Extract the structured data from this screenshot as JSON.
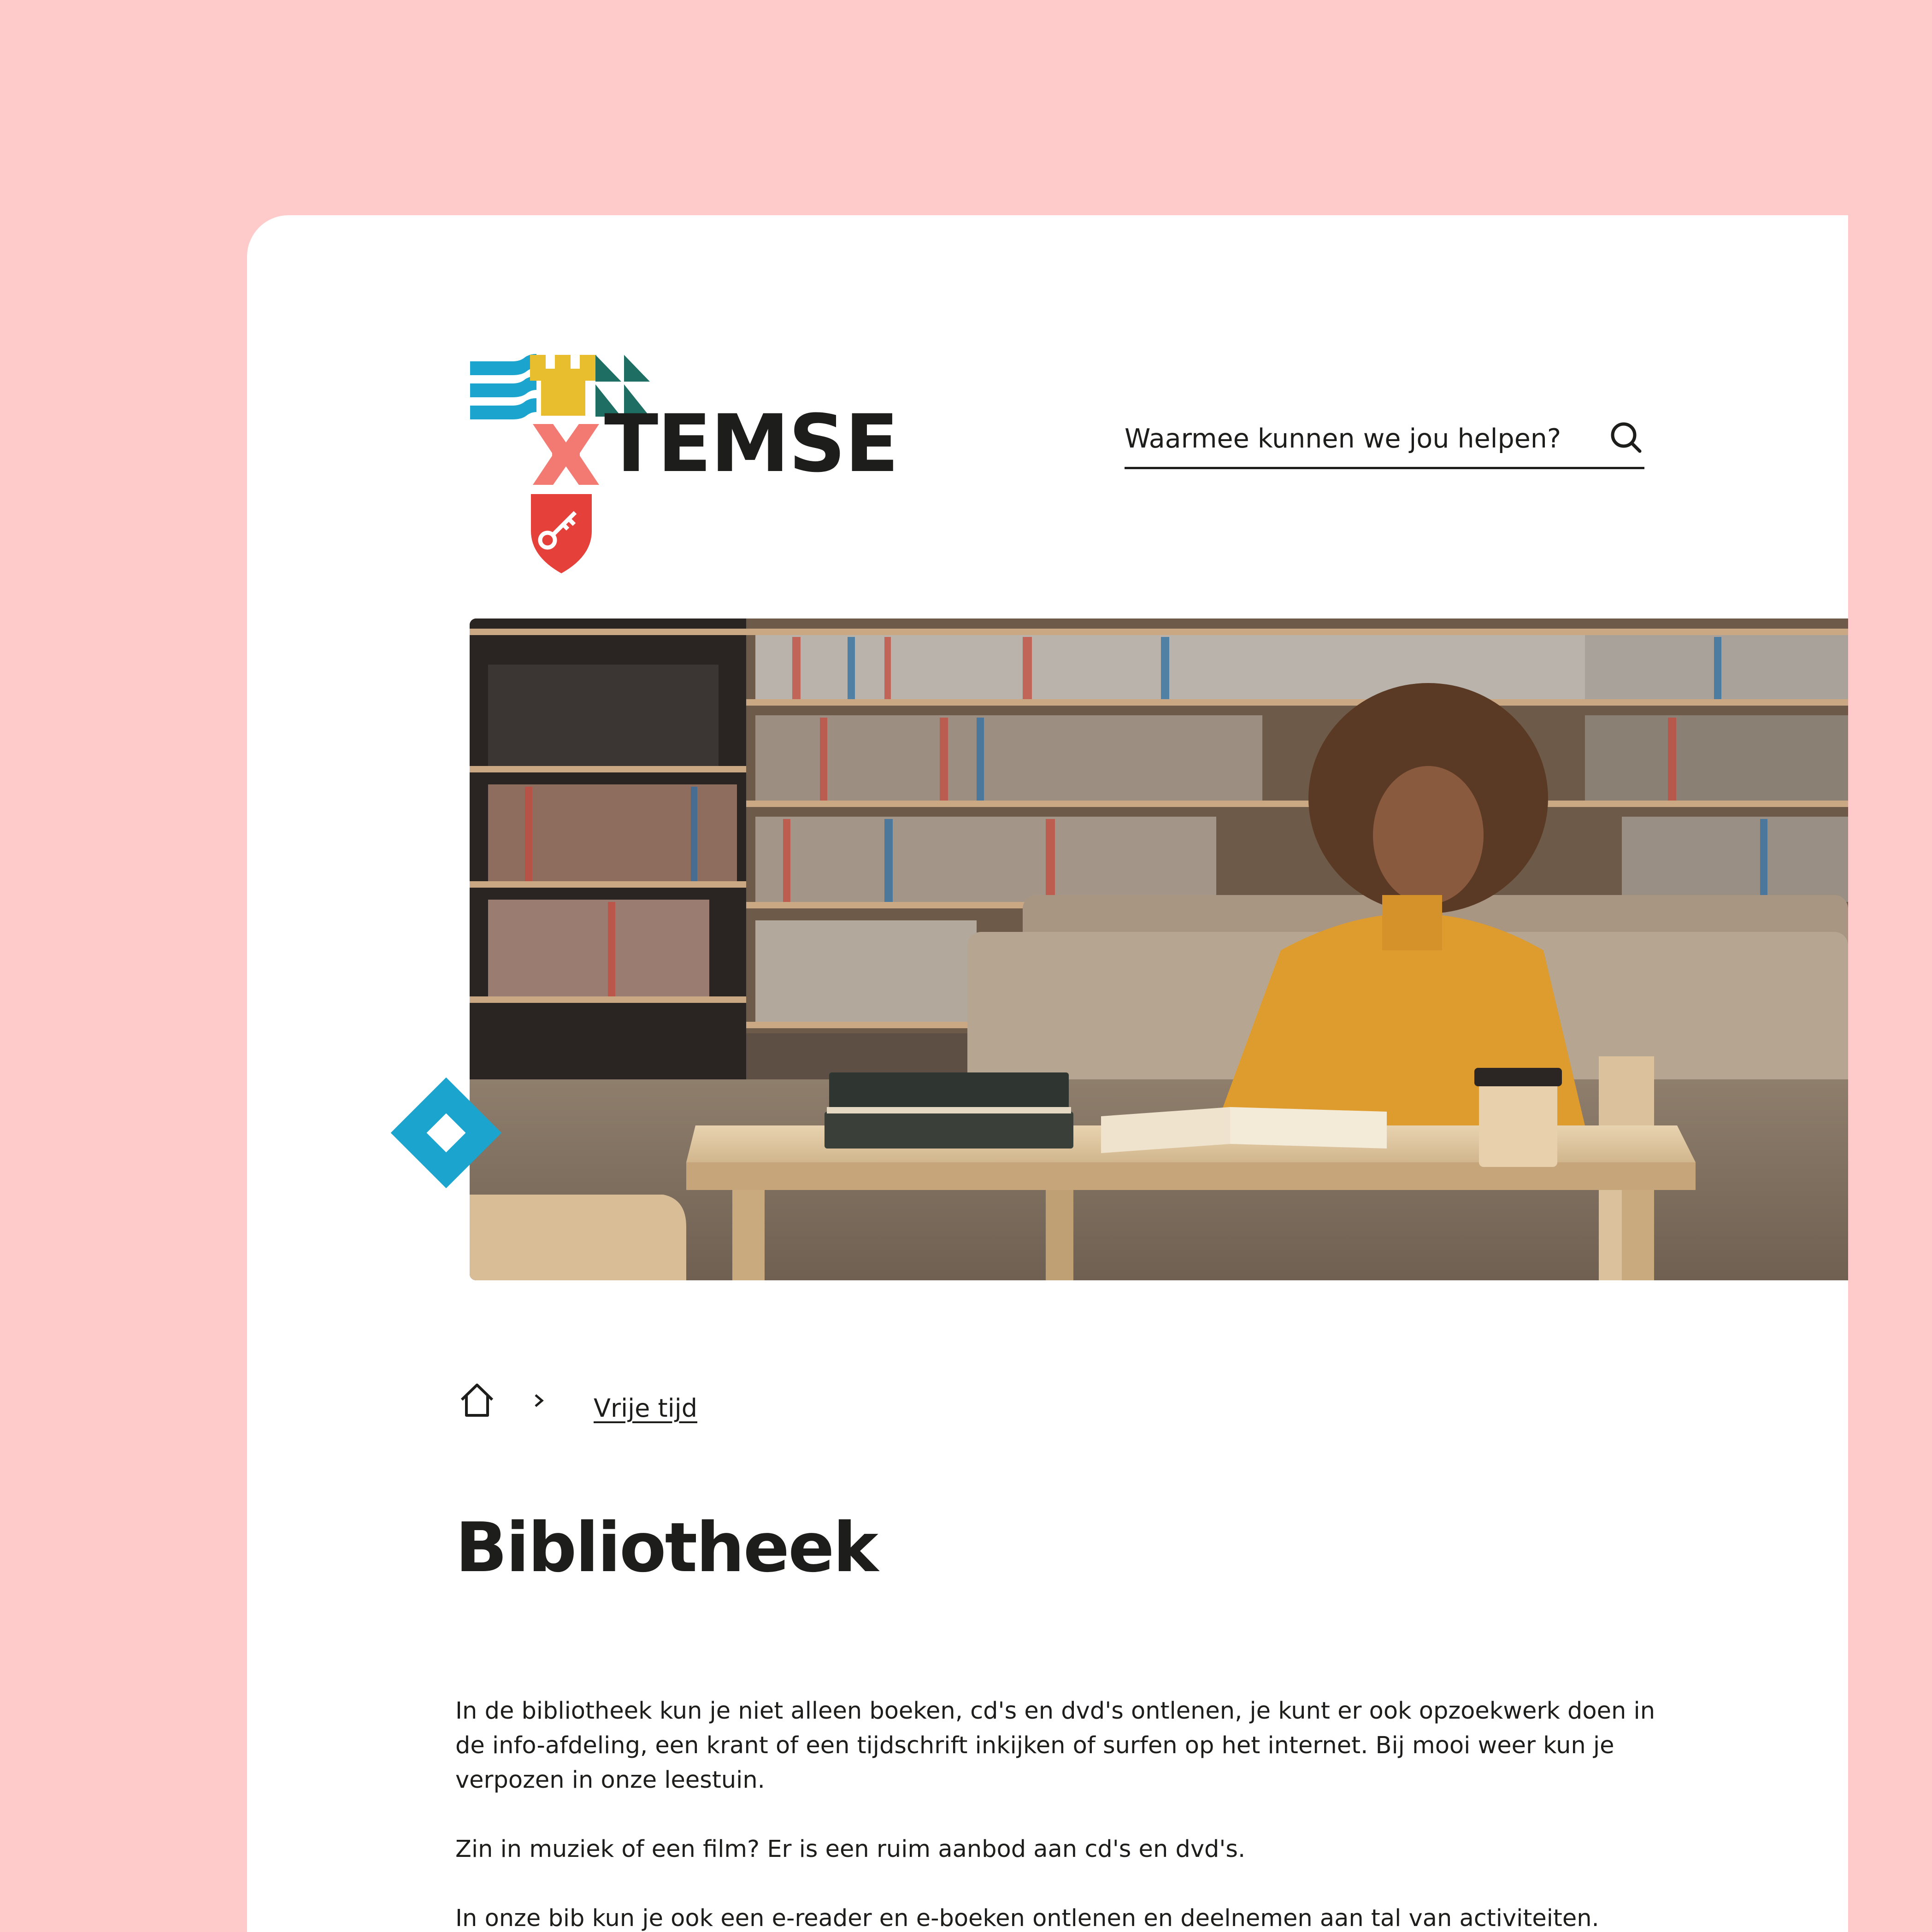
{
  "brand": {
    "name": "TEMSE",
    "colors": {
      "page_background": "#FFCBCA",
      "blue": "#1BA4CE",
      "yellow": "#E8BD2E",
      "teal": "#1F6E64",
      "coral": "#F27A73",
      "red": "#E5403A",
      "text": "#1D1D1B"
    }
  },
  "header": {
    "search": {
      "placeholder": "Waarmee kunnen we jou helpen?",
      "icon": "search-icon"
    }
  },
  "hero": {
    "icon": "diamond-icon"
  },
  "breadcrumb": {
    "home_icon": "home-icon",
    "separator_icon": "chevron-right-icon",
    "link": "Vrije tijd"
  },
  "page": {
    "title": "Bibliotheek",
    "paragraphs": [
      "In de bibliotheek kun je niet alleen boeken, cd's en dvd's ontlenen, je kunt er ook opzoekwerk doen in de info-afdeling, een krant of een tijdschrift inkijken of surfen op het internet. Bij mooi weer kun je verpozen in onze leestuin.",
      "Zin in muziek of een film? Er is een ruim aanbod aan cd's en dvd's.",
      "In onze bib kun je ook een e-reader en e-boeken ontlenen en deelnemen aan tal van activiteiten."
    ]
  }
}
